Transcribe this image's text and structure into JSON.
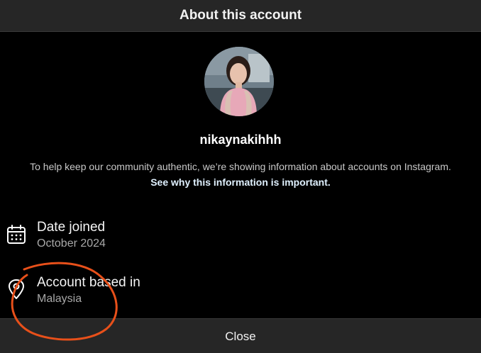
{
  "header": {
    "title": "About this account"
  },
  "profile": {
    "username": "nikaynakihhh",
    "info_text": "To help keep our community authentic, we’re showing information about accounts on Instagram.",
    "info_link": "See why this information is important."
  },
  "details": [
    {
      "label": "Date joined",
      "value": "October 2024",
      "icon": "calendar-icon"
    },
    {
      "label": "Account based in",
      "value": "Malaysia",
      "icon": "location-pin-icon"
    }
  ],
  "footer": {
    "close_label": "Close"
  },
  "colors": {
    "background": "#000000",
    "header_bg": "#262626",
    "annotation": "#e8501a",
    "link": "#e0f1ff",
    "secondary_text": "#a8a8a8"
  }
}
